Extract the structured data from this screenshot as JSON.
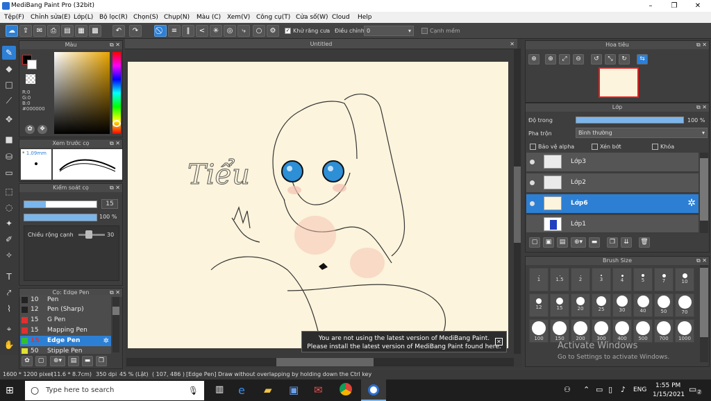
{
  "window": {
    "title": "MediBang Paint Pro (32bit)",
    "min": "–",
    "max": "❐",
    "close": "✕"
  },
  "menu": [
    "Tệp(F)",
    "Chỉnh sửa(E)",
    "Lớp(L)",
    "Bộ lọc(R)",
    "Chọn(S)",
    "Chụp(N)",
    "Màu (C)",
    "Xem(V)",
    "Công cụ(T)",
    "Cửa số(W)",
    "Cloud",
    "Help"
  ],
  "toolbar": {
    "antialias_label": "Khử răng cưa",
    "adjust_label": "Điều chỉnh",
    "adjust_value": "0",
    "soft_edge_label": "Cạnh mềm"
  },
  "color_panel": {
    "title": "Màu",
    "r": "R:0",
    "g": "G:0",
    "b": "B:0",
    "hex": "#000000"
  },
  "preview_panel": {
    "title": "Xem trước cọ",
    "size": "1.09mm",
    "star": "*"
  },
  "brush_control": {
    "title": "Kiểm soát cọ",
    "size_value": "15",
    "opacity_value": "100 %",
    "edge_label": "Chiều rộng cạnh",
    "edge_value": "30"
  },
  "pen_panel": {
    "title": "Cọ: Edge Pen",
    "pens": [
      {
        "size": "10",
        "name": "Pen",
        "color": "#222222"
      },
      {
        "size": "12",
        "name": "Pen (Sharp)",
        "color": "#222222"
      },
      {
        "size": "15",
        "name": "G Pen",
        "color": "#e03030"
      },
      {
        "size": "15",
        "name": "Mapping Pen",
        "color": "#e03030"
      },
      {
        "size": "15",
        "name": "Edge Pen",
        "color": "#30c030"
      },
      {
        "size": "50",
        "name": "Stipple Pen",
        "color": "#e0e030"
      }
    ]
  },
  "canvas": {
    "tab": "Untitled",
    "handwriting": "Tiểu"
  },
  "toast": {
    "line1": "You are not using the latest version of MediBang Paint.",
    "line2": "Please install the latest version of MediBang Paint found here."
  },
  "navigator": {
    "title": "Hoa tiêu"
  },
  "layer_panel": {
    "title": "Lớp",
    "opacity_label": "Độ trong",
    "opacity_value": "100 %",
    "opacity_fraction": 1.0,
    "blend_label": "Pha trộn",
    "blend_value": "Bình thường",
    "protect_alpha": "Bảo vệ alpha",
    "clip": "Xén bớt",
    "lock": "Khóa",
    "layers": [
      {
        "name": "Lớp3"
      },
      {
        "name": "Lớp2"
      },
      {
        "name": "Lớp6",
        "selected": true
      },
      {
        "name": "Lớp1"
      }
    ]
  },
  "brush_size": {
    "title": "Brush Size",
    "sizes": [
      "1",
      "1.5",
      "2",
      "3",
      "4",
      "5",
      "7",
      "10",
      "12",
      "15",
      "20",
      "25",
      "30",
      "40",
      "50",
      "70",
      "100",
      "150",
      "200",
      "300",
      "400",
      "500",
      "700",
      "1000"
    ]
  },
  "status": {
    "dims": "1600 * 1200 pixel",
    "cm": "(11.6 * 8.7cm)",
    "dpi": "350 dpi",
    "zoom": "45 % (Lật)",
    "coords": "( 107, 486 )",
    "hint": "[Edge Pen] Draw without overlapping by holding down the Ctrl key"
  },
  "watermark": {
    "line1": "Activate Windows",
    "line2": "Go to Settings to activate Windows."
  },
  "taskbar": {
    "search": "Type here to search",
    "lang": "ENG",
    "time": "1:55 PM",
    "date": "1/15/2021",
    "notif": "2"
  }
}
